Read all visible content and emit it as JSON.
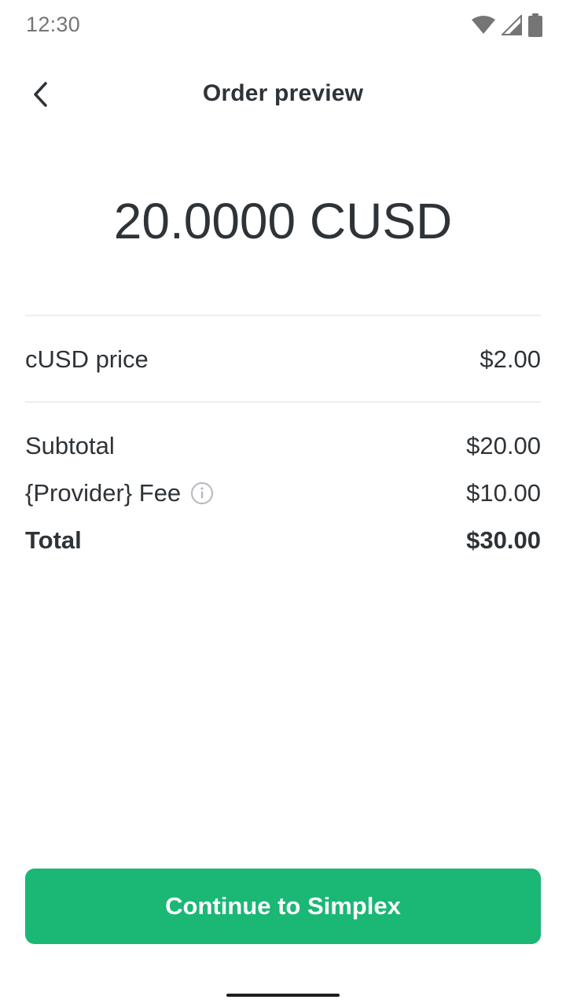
{
  "status_bar": {
    "time": "12:30",
    "icons": [
      "wifi-icon",
      "cellular-signal-icon",
      "battery-icon"
    ]
  },
  "header": {
    "back_icon": "chevron-left-icon",
    "title": "Order preview"
  },
  "order": {
    "amount": "20.0000 CUSD",
    "price_label": "cUSD price",
    "price_value": "$2.00",
    "subtotal_label": "Subtotal",
    "subtotal_value": "$20.00",
    "fee_label": "{Provider} Fee",
    "fee_info_icon": "info-icon",
    "fee_value": "$10.00",
    "total_label": "Total",
    "total_value": "$30.00"
  },
  "actions": {
    "continue_label": "Continue to Simplex"
  },
  "colors": {
    "accent": "#1ab775",
    "text": "#2e3338",
    "divider": "#edeeef",
    "status_gray": "#757575"
  }
}
